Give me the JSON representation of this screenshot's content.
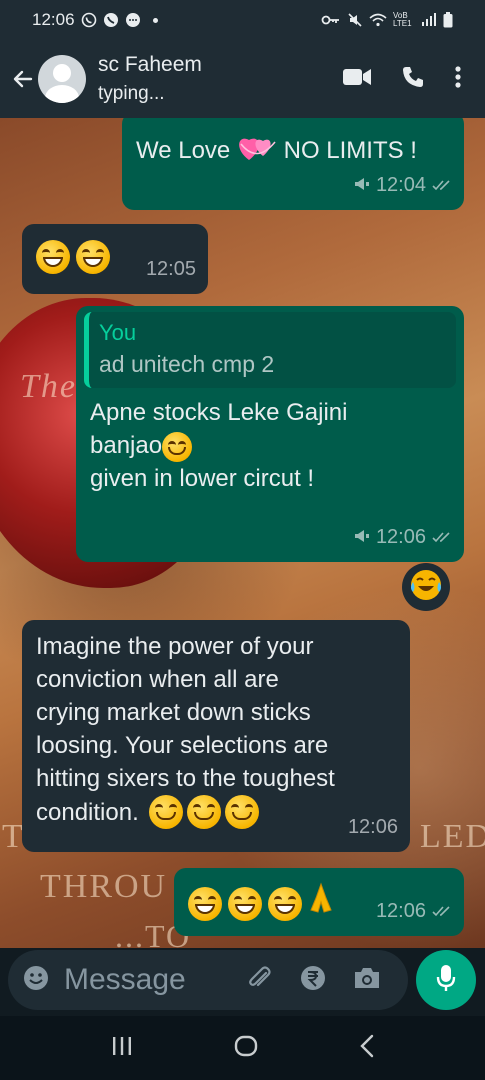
{
  "status_bar": {
    "time": "12:06",
    "network_label": "VoB LTE1"
  },
  "header": {
    "contact_name": "sc Faheem",
    "contact_status": "typing..."
  },
  "messages": [
    {
      "direction": "out",
      "text_before": "We Love",
      "emoji": "sparkling-heart-icon",
      "text_after": "NO LIMITS !",
      "time": "12:04"
    },
    {
      "direction": "in",
      "emoji": [
        "grinning-face-icon",
        "grinning-face-icon"
      ],
      "time": "12:05"
    },
    {
      "direction": "out",
      "quote_author": "You",
      "quote_text": "ad unitech cmp 2",
      "line1": "Apne stocks Leke Gajini",
      "line2": "banjao",
      "line3": "given in lower circut !",
      "time": "12:06",
      "reaction": "face-with-tears-of-joy-icon"
    },
    {
      "direction": "in",
      "lines": [
        "Imagine the power of your",
        "conviction when all are",
        "crying market down sticks",
        "loosing. Your selections are",
        "hitting sixers to the toughest",
        "condition."
      ],
      "time": "12:06"
    },
    {
      "direction": "out",
      "emoji": [
        "grinning-face-icon",
        "grinning-face-icon",
        "grinning-face-icon",
        "folded-hands-icon"
      ],
      "time": "12:06"
    }
  ],
  "input": {
    "placeholder": "Message"
  },
  "colors": {
    "outgoing": "#005c4b",
    "incoming": "#1f2c34",
    "accent": "#00a884",
    "header": "#1f2c34"
  }
}
